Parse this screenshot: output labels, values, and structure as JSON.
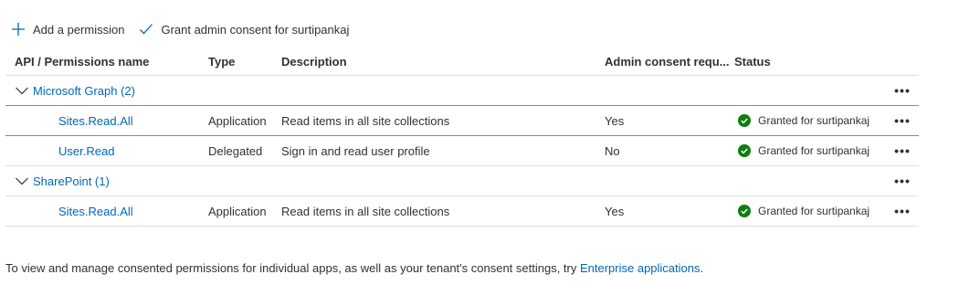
{
  "toolbar": {
    "add_permission": "Add a permission",
    "grant_consent": "Grant admin consent for surtipankaj"
  },
  "columns": {
    "name": "API / Permissions name",
    "type": "Type",
    "description": "Description",
    "admin": "Admin consent requ...",
    "status": "Status"
  },
  "groups": [
    {
      "label": "Microsoft Graph (2)",
      "permissions": [
        {
          "name": "Sites.Read.All",
          "type": "Application",
          "description": "Read items in all site collections",
          "admin": "Yes",
          "status": "Granted for surtipankaj"
        },
        {
          "name": "User.Read",
          "type": "Delegated",
          "description": "Sign in and read user profile",
          "admin": "No",
          "status": "Granted for surtipankaj"
        }
      ]
    },
    {
      "label": "SharePoint (1)",
      "permissions": [
        {
          "name": "Sites.Read.All",
          "type": "Application",
          "description": "Read items in all site collections",
          "admin": "Yes",
          "status": "Granted for surtipankaj"
        }
      ]
    }
  ],
  "more_glyph": "•••",
  "footer": {
    "text": "To view and manage consented permissions for individual apps, as well as your tenant's consent settings, try ",
    "link": "Enterprise applications",
    "end": "."
  },
  "colors": {
    "accent": "#0067b8",
    "success": "#107c10",
    "text": "#323130",
    "divider": "#e1dfdd"
  }
}
